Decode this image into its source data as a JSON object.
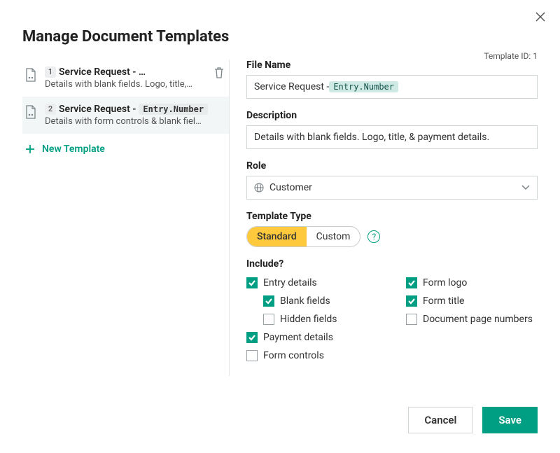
{
  "dialog": {
    "title": "Manage Document Templates",
    "template_id_label": "Template ID: 1"
  },
  "sidebar": {
    "items": [
      {
        "num": "1",
        "title_prefix": "Service Request - …",
        "token": "",
        "desc": "Details with blank fields. Logo, title,…",
        "selected": false,
        "show_trash": true
      },
      {
        "num": "2",
        "title_prefix": "Service Request -",
        "token": "Entry.Number",
        "desc": "Details with form controls & blank fiel…",
        "selected": true,
        "show_trash": false
      }
    ],
    "new_template_label": "New Template"
  },
  "form": {
    "file_name_label": "File Name",
    "file_name_prefix": "Service Request - ",
    "file_name_token": "Entry.Number",
    "description_label": "Description",
    "description_value": "Details with blank fields. Logo, title, & payment details.",
    "role_label": "Role",
    "role_value": "Customer",
    "template_type_label": "Template Type",
    "type_options": [
      "Standard",
      "Custom"
    ],
    "type_selected": "Standard",
    "include_label": "Include?",
    "include_left": [
      {
        "label": "Entry details",
        "checked": true,
        "indent": false
      },
      {
        "label": "Blank fields",
        "checked": true,
        "indent": true
      },
      {
        "label": "Hidden fields",
        "checked": false,
        "indent": true
      },
      {
        "label": "Payment details",
        "checked": true,
        "indent": false
      },
      {
        "label": "Form controls",
        "checked": false,
        "indent": false
      }
    ],
    "include_right": [
      {
        "label": "Form logo",
        "checked": true,
        "indent": false
      },
      {
        "label": "Form title",
        "checked": true,
        "indent": false
      },
      {
        "label": "Document page numbers",
        "checked": false,
        "indent": false
      }
    ]
  },
  "footer": {
    "cancel": "Cancel",
    "save": "Save"
  }
}
